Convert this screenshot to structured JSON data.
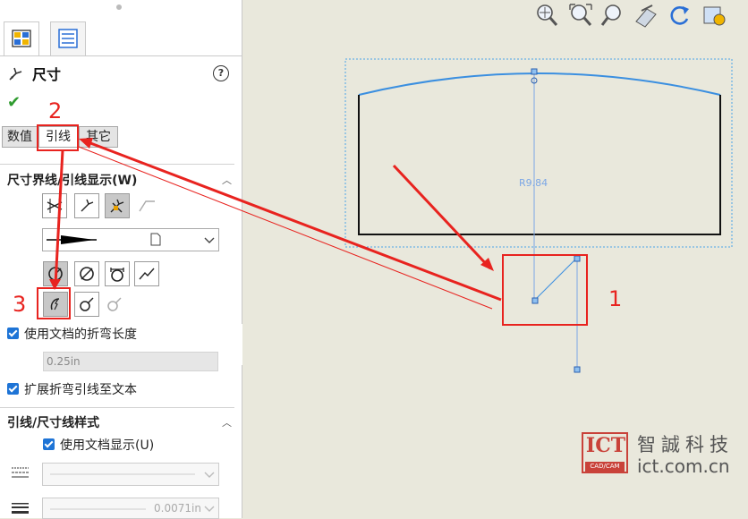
{
  "panel": {
    "title": "尺寸",
    "help_label": "?",
    "ok_glyph": "✔",
    "tabs": [
      "数值",
      "引线",
      "其它"
    ],
    "section1": {
      "title": "尺寸界线/引线显示(W)"
    },
    "arrow_style_selected": "filled-arrow",
    "checkbox1": {
      "label": "使用文档的折弯长度",
      "checked": true
    },
    "bend_length": {
      "value": "0.25in"
    },
    "checkbox2": {
      "label": "扩展折弯引线至文本",
      "checked": true
    },
    "section2": {
      "title": "引线/尺寸线样式"
    },
    "checkbox3": {
      "label": "使用文档显示(U)",
      "checked": true
    },
    "line_thickness": {
      "value": "0.0071in"
    }
  },
  "canvas": {
    "dimension_label": "R9.84"
  },
  "annotations": {
    "step1": "1",
    "step2": "2",
    "step3": "3"
  },
  "watermark": {
    "logo_text": "ICT",
    "logo_sub": "CAD/CAM",
    "chinese": "智誠科技",
    "url": "ict.com.cn"
  },
  "toolbar_icons": [
    "zoom-to-fit-icon",
    "zoom-to-area-icon",
    "zoom-in-out-icon",
    "section-view-icon",
    "rotate-icon",
    "view-settings-icon"
  ],
  "colors": {
    "accent_red": "#e8231f",
    "dim_blue": "#7aa6e6",
    "check_blue": "#1e74d6"
  }
}
